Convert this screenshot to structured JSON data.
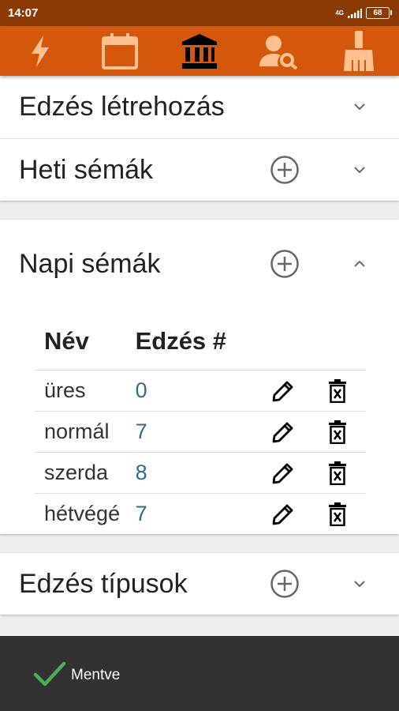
{
  "status": {
    "time": "14:07",
    "network": "4G",
    "battery": "68"
  },
  "toolbar": {
    "icons": [
      "lightning-icon",
      "calendar-icon",
      "institution-icon",
      "user-search-icon",
      "broom-icon"
    ]
  },
  "sections": {
    "create_workout": {
      "title": "Edzés létrehozás"
    },
    "weekly_schemas": {
      "title": "Heti sémák"
    },
    "daily_schemas": {
      "title": "Napi sémák",
      "columns": [
        "Név",
        "Edzés #"
      ],
      "rows": [
        {
          "name": "üres",
          "count": "0"
        },
        {
          "name": "normál",
          "count": "7"
        },
        {
          "name": "szerda",
          "count": "8"
        },
        {
          "name": "hétvégé",
          "count": "7"
        }
      ]
    },
    "workout_types": {
      "title": "Edzés típusok"
    }
  },
  "snackbar": {
    "message": "Mentve"
  },
  "colors": {
    "statusbar": "#8c3a05",
    "toolbar": "#d3580b",
    "accent_value": "#2f6e86",
    "snackbar": "#323232",
    "check": "#4caf50"
  }
}
